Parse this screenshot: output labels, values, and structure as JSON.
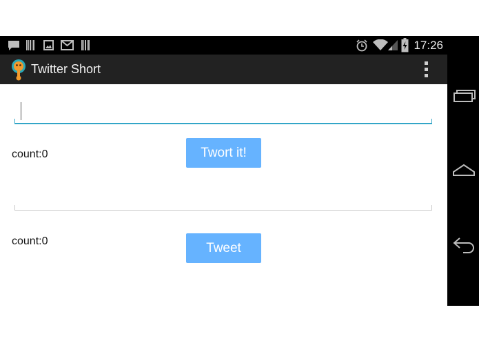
{
  "status_bar": {
    "time": "17:26",
    "left_icons": [
      "chat-notification-icon",
      "barcode-icon",
      "image-icon",
      "gmail-icon",
      "barcode-icon"
    ],
    "right_icons": [
      "alarm-icon",
      "wifi-icon",
      "signal-icon",
      "battery-charging-icon"
    ]
  },
  "action_bar": {
    "title": "Twitter Short",
    "app_icon": "app-logo-icon",
    "menu_icon": "overflow-menu-icon"
  },
  "form": {
    "top_input_value": "",
    "top_count": "count:0",
    "twort_button": "Twort it!",
    "bottom_input_value": "",
    "bottom_count": "count:0",
    "tweet_button": "Tweet"
  },
  "nav_bar": {
    "buttons": [
      "recent-apps-icon",
      "home-icon",
      "back-icon"
    ]
  },
  "colors": {
    "button": "#66b3ff",
    "input_active": "#33a6c8",
    "action_bar": "#222222"
  }
}
